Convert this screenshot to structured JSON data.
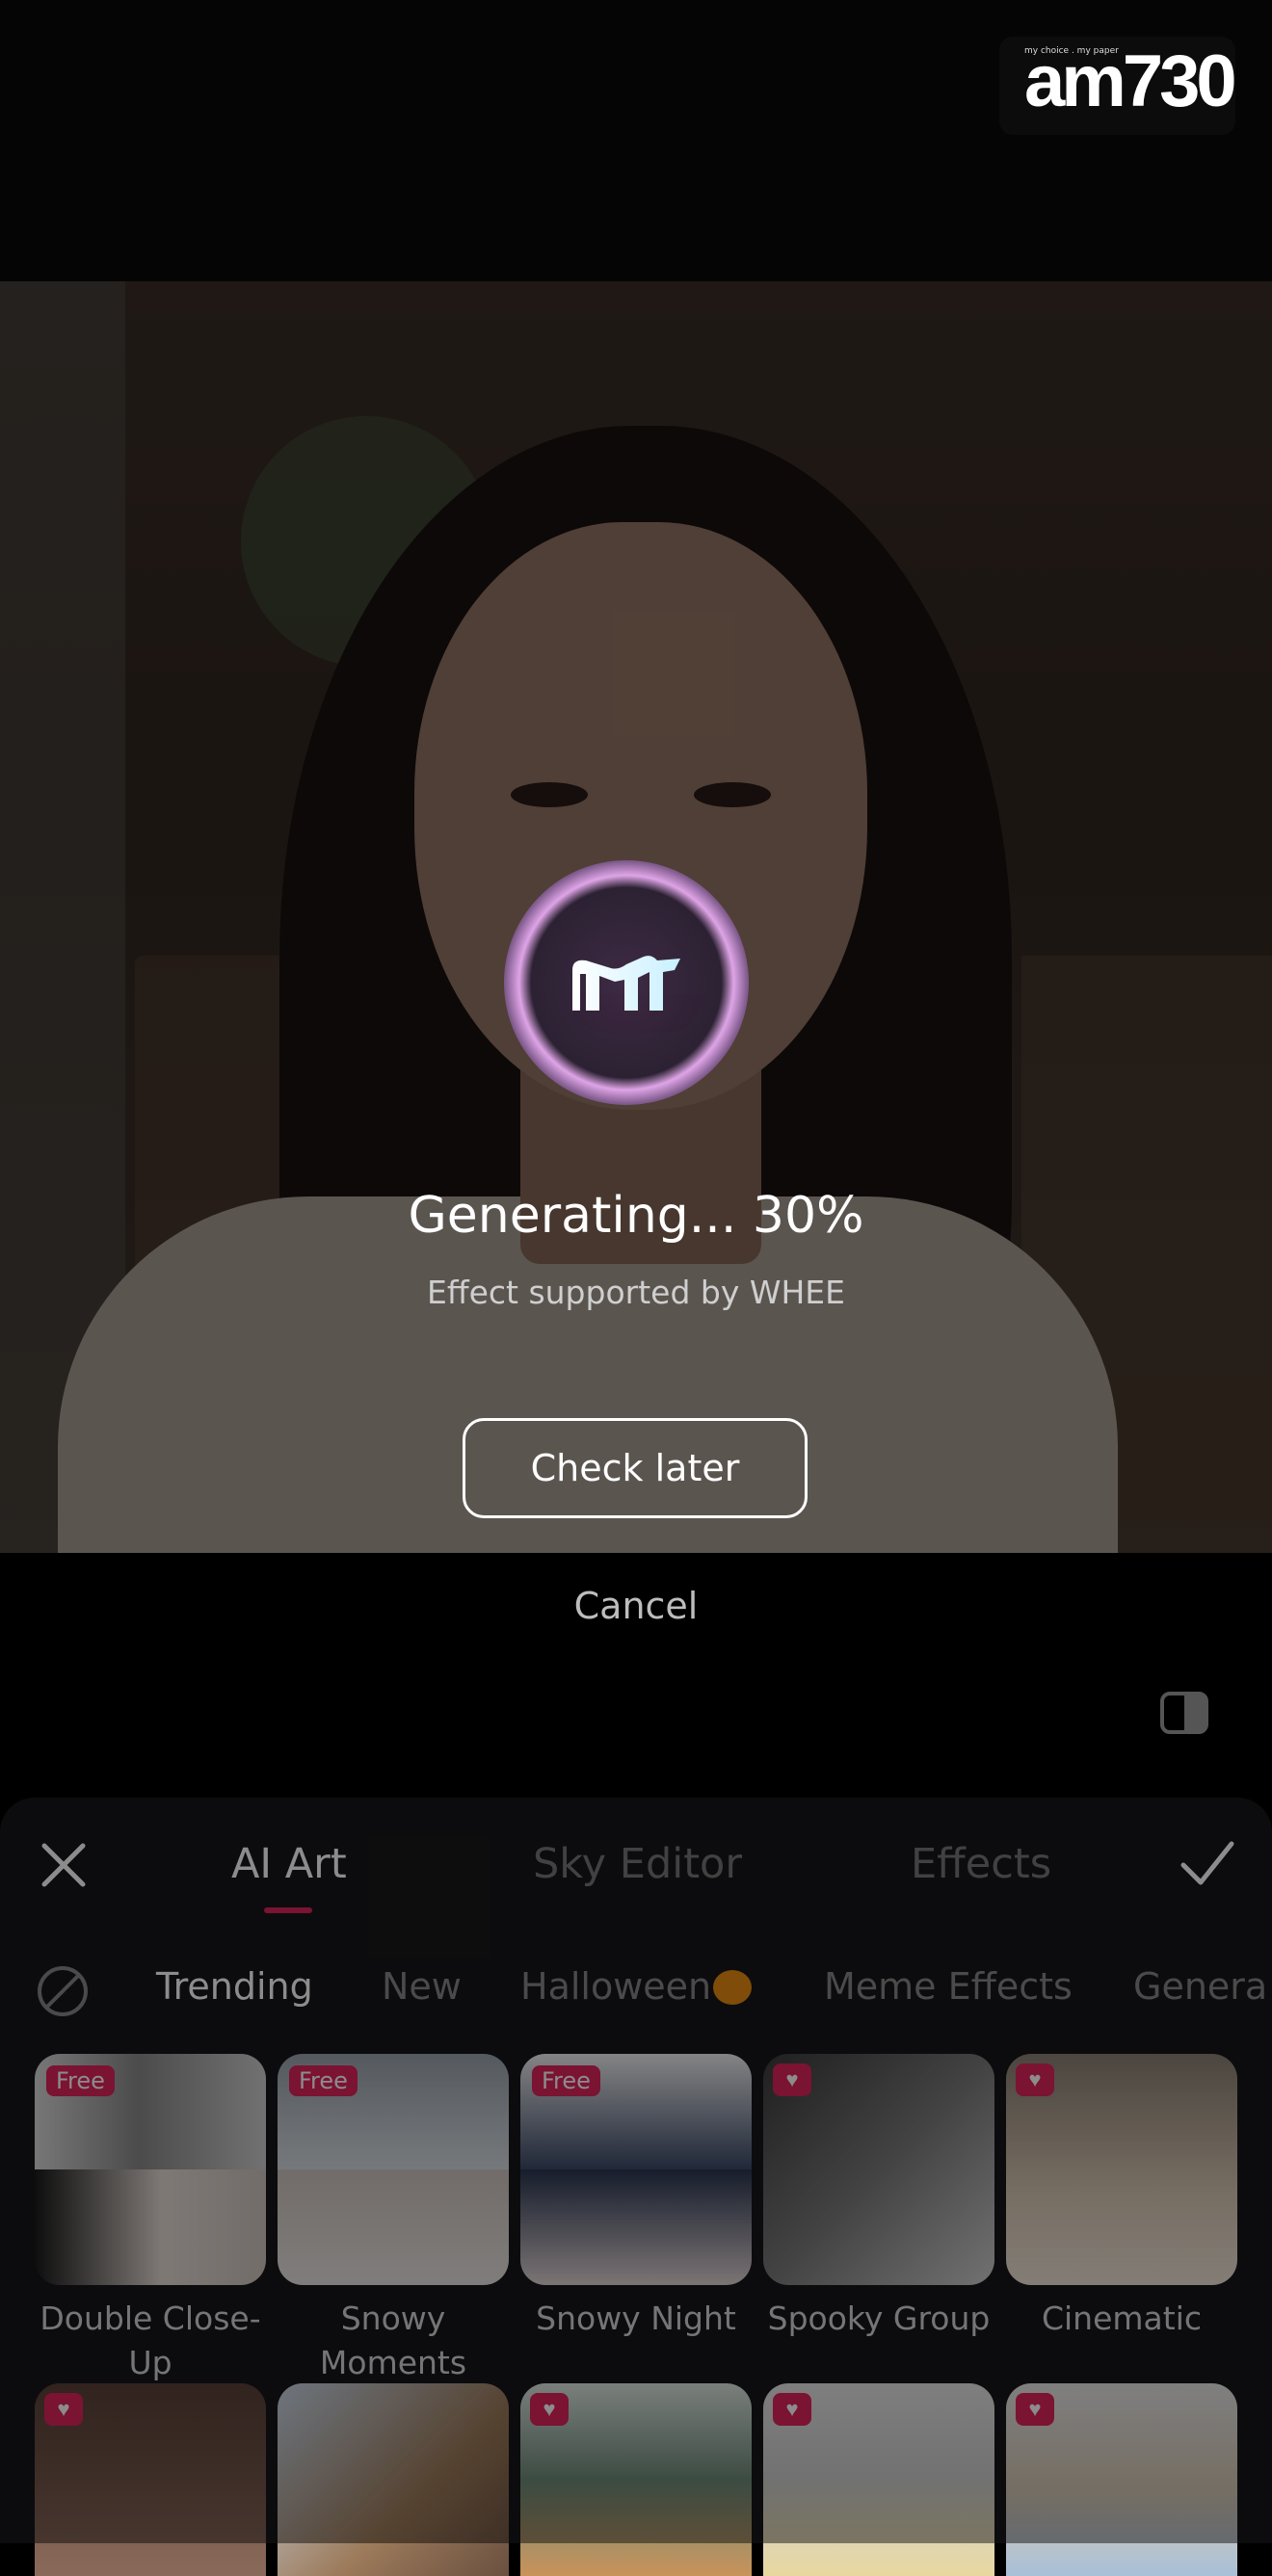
{
  "watermark": {
    "tagline": "my choice . my paper",
    "brand": "am730"
  },
  "progress": {
    "text": "Generating... 30%",
    "percent": 30,
    "subtitle": "Effect supported by WHEE"
  },
  "actions": {
    "check_later": "Check later",
    "cancel": "Cancel"
  },
  "panel": {
    "tabs": [
      {
        "label": "AI Art",
        "active": true
      },
      {
        "label": "Sky Editor",
        "active": false
      },
      {
        "label": "Effects",
        "active": false
      }
    ],
    "categories": [
      {
        "label": "Trending",
        "active": true
      },
      {
        "label": "New",
        "active": false
      },
      {
        "label": "Halloween",
        "active": false
      },
      {
        "label": "Meme Effects",
        "active": false
      },
      {
        "label": "Genera",
        "active": false
      }
    ],
    "effects_row1": [
      {
        "label": "Double Close-Up",
        "badge": "Free"
      },
      {
        "label": "Snowy Moments",
        "badge": "Free"
      },
      {
        "label": "Snowy Night",
        "badge": "Free"
      },
      {
        "label": "Spooky Group",
        "badge": "heart"
      },
      {
        "label": "Cinematic",
        "badge": "heart"
      }
    ],
    "effects_row2_badges": [
      "heart",
      "",
      "heart",
      "heart",
      "heart"
    ]
  },
  "colors": {
    "accent": "#e0245e",
    "panel": "#17171a"
  },
  "icons": [
    "close-icon",
    "checkmark-icon",
    "no-effect-icon",
    "compare-icon",
    "meitu-logo-icon",
    "pumpkin-icon",
    "heart-icon"
  ]
}
